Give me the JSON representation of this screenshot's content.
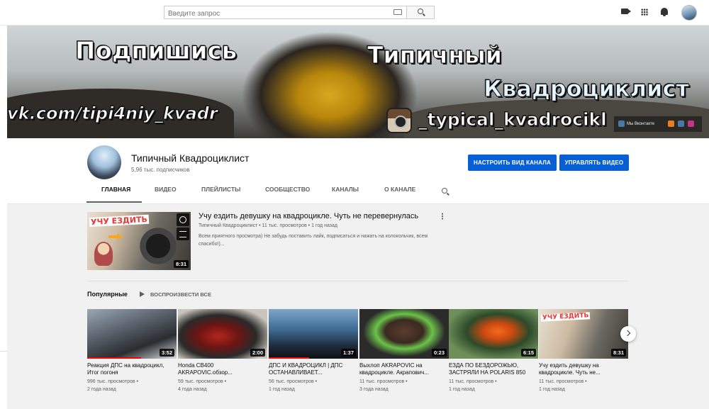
{
  "search": {
    "placeholder": "Введите запрос"
  },
  "banner": {
    "subscribe": "Подпишись",
    "title_line1": "Типичный",
    "title_line2": "Квадроциклист",
    "vk": "vk.com/tipi4niy_kvadr",
    "instagram": "_typical_kvadrocikl",
    "social_label": "Мы Вконтакте"
  },
  "channel": {
    "name": "Типичный Квадроциклист",
    "subscribers": "5,96 тыс. подписчиков",
    "customize_button": "НАСТРОИТЬ ВИД КАНАЛА",
    "manage_button": "УПРАВЛЯТЬ ВИДЕО"
  },
  "tabs": [
    {
      "label": "ГЛАВНАЯ"
    },
    {
      "label": "ВИДЕО"
    },
    {
      "label": "ПЛЕЙЛИСТЫ"
    },
    {
      "label": "СООБЩЕСТВО"
    },
    {
      "label": "КАНАЛЫ"
    },
    {
      "label": "О КАНАЛЕ"
    }
  ],
  "featured": {
    "thumb_text": "УЧУ ЕЗДИТЬ",
    "duration": "8:31",
    "title": "Учу ездить девушку на квадроцикле. Чуть не перевернулась",
    "meta": "Типичный Квадроциклист • 11 тыс. просмотров • 1 год назад",
    "description": "Всем приятного просмотра) Не забудь поставить лайк, подписаться и нажать на колокольчик, всем спасибо!)..."
  },
  "popular": {
    "title": "Популярные",
    "play_all": "ВОСПРОИЗВЕСТИ ВСЕ",
    "videos": [
      {
        "title": "Реакция ДПС на квадроцикл, Итог погоня",
        "views": "996 тыс. просмотров •",
        "date": "2 года назад",
        "duration": "3:52"
      },
      {
        "title": "Honda CB400 AKRAPOVIC.обзор...",
        "views": "59 тыс. просмотров •",
        "date": "4 года назад",
        "duration": "2:00"
      },
      {
        "title": "ДПС И КВАДРОЦИКЛ | ДПС ОСТАНАВЛИВАЕТ...",
        "views": "56 тыс. просмотров •",
        "date": "1 год назад",
        "duration": "1:37"
      },
      {
        "title": "Выхлоп AKRAPOVIC на квадроцикле. Акрапович...",
        "views": "11 тыс. просмотров •",
        "date": "3 года назад",
        "duration": "0:23"
      },
      {
        "title": "ЕЗДА ПО БЕЗДОРОЖЬЮ, ЗАСТРЯЛИ НА POLARIS 850",
        "views": "11 тыс. просмотров •",
        "date": "1 год назад",
        "duration": "6:15"
      },
      {
        "title": "Учу ездить девушку на квадроцикле. Чуть не...",
        "views": "11 тыс. просмотров •",
        "date": "1 год назад",
        "duration": "8:31"
      }
    ]
  },
  "colors": {
    "accent_blue": "#065fd4",
    "progress_red": "#ff0000",
    "content_bg": "#f1f1f1"
  }
}
